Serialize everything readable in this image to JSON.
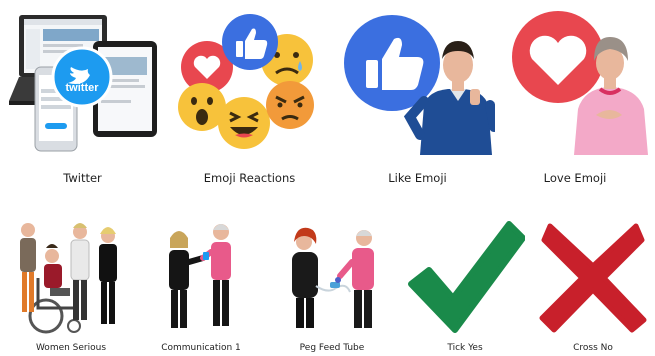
{
  "gallery": {
    "items": [
      {
        "label": "Twitter",
        "icon": "twitter-devices-picture",
        "logo_text": "twitter"
      },
      {
        "label": "Emoji Reactions",
        "icon": "emoji-reactions-picture"
      },
      {
        "label": "Like Emoji",
        "icon": "like-emoji-picture"
      },
      {
        "label": "Love Emoji",
        "icon": "love-emoji-picture"
      },
      {
        "label": "Women Serious",
        "icon": "women-serious-picture"
      },
      {
        "label": "Communication 1",
        "icon": "communication-picture"
      },
      {
        "label": "Peg Feed Tube",
        "icon": "peg-feed-tube-picture"
      },
      {
        "label": "Tick Yes",
        "icon": "tick-icon"
      },
      {
        "label": "Cross No",
        "icon": "cross-icon"
      }
    ]
  },
  "colors": {
    "facebook_blue": "#3b6fe0",
    "love_red": "#e8474f",
    "emoji_yellow": "#f7c23b",
    "tick_green": "#1a8a4a",
    "cross_red": "#c8202b"
  }
}
